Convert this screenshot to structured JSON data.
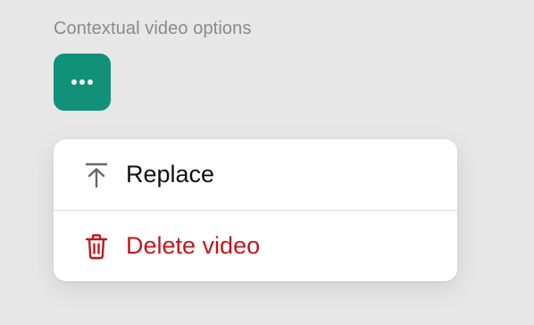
{
  "section": {
    "label": "Contextual video options"
  },
  "options_button": {
    "icon": "more-horizontal-icon",
    "color": "#11907a"
  },
  "menu": {
    "items": [
      {
        "label": "Replace",
        "icon": "upload-icon",
        "color": "#111111"
      },
      {
        "label": "Delete video",
        "icon": "trash-icon",
        "color": "#c0171c"
      }
    ]
  }
}
